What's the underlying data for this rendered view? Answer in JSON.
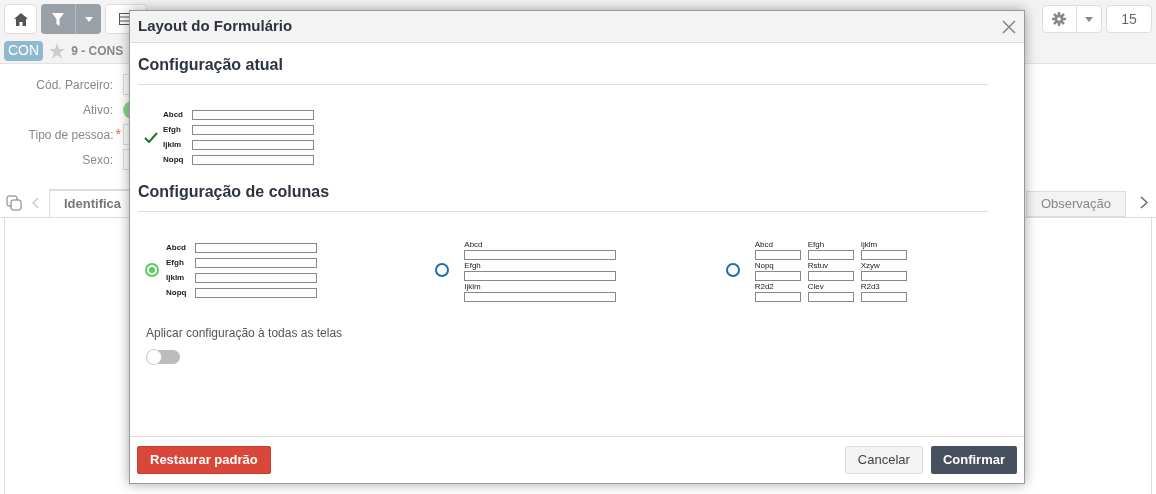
{
  "toolbar": {
    "counter": "15"
  },
  "record": {
    "badge": "CON",
    "starred": false,
    "title": "9 - CONS"
  },
  "form_fields": [
    {
      "label": "Cód. Parceiro:",
      "required": false,
      "kind": "text"
    },
    {
      "label": "Ativo:",
      "required": false,
      "kind": "switch",
      "on": true
    },
    {
      "label": "Tipo de pessoa:",
      "required": true,
      "required_mark": "*",
      "kind": "text"
    },
    {
      "label": "Sexo:",
      "required": false,
      "kind": "text"
    }
  ],
  "tabs": [
    {
      "label": "Identifica",
      "selected": true
    },
    {
      "label": "Observação",
      "selected": false
    }
  ],
  "dialog": {
    "title": "Layout do Formulário",
    "current_heading": "Configuração atual",
    "current_labels": [
      "Abcd",
      "Efgh",
      "Ijklm",
      "Nopq"
    ],
    "columns_heading": "Configuração de colunas",
    "options": [
      {
        "kind": "one-column",
        "selected": true,
        "labels": [
          "Abcd",
          "Efgh",
          "Ijklm",
          "Nopq"
        ]
      },
      {
        "kind": "stacked",
        "selected": false,
        "labels": [
          "Abcd",
          "Efgh",
          "Ijklm"
        ]
      },
      {
        "kind": "grid",
        "selected": false,
        "labels": [
          "Abcd",
          "Efgh",
          "Ijklm",
          "Nopq",
          "Rstuv",
          "Xzyw",
          "R2d2",
          "Clev",
          "R2d3"
        ]
      }
    ],
    "apply_all": {
      "label": "Aplicar configuração à todas as telas",
      "on": false
    },
    "restore_button": "Restaurar padrão",
    "cancel_button": "Cancelar",
    "confirm_button": "Confirmar"
  }
}
